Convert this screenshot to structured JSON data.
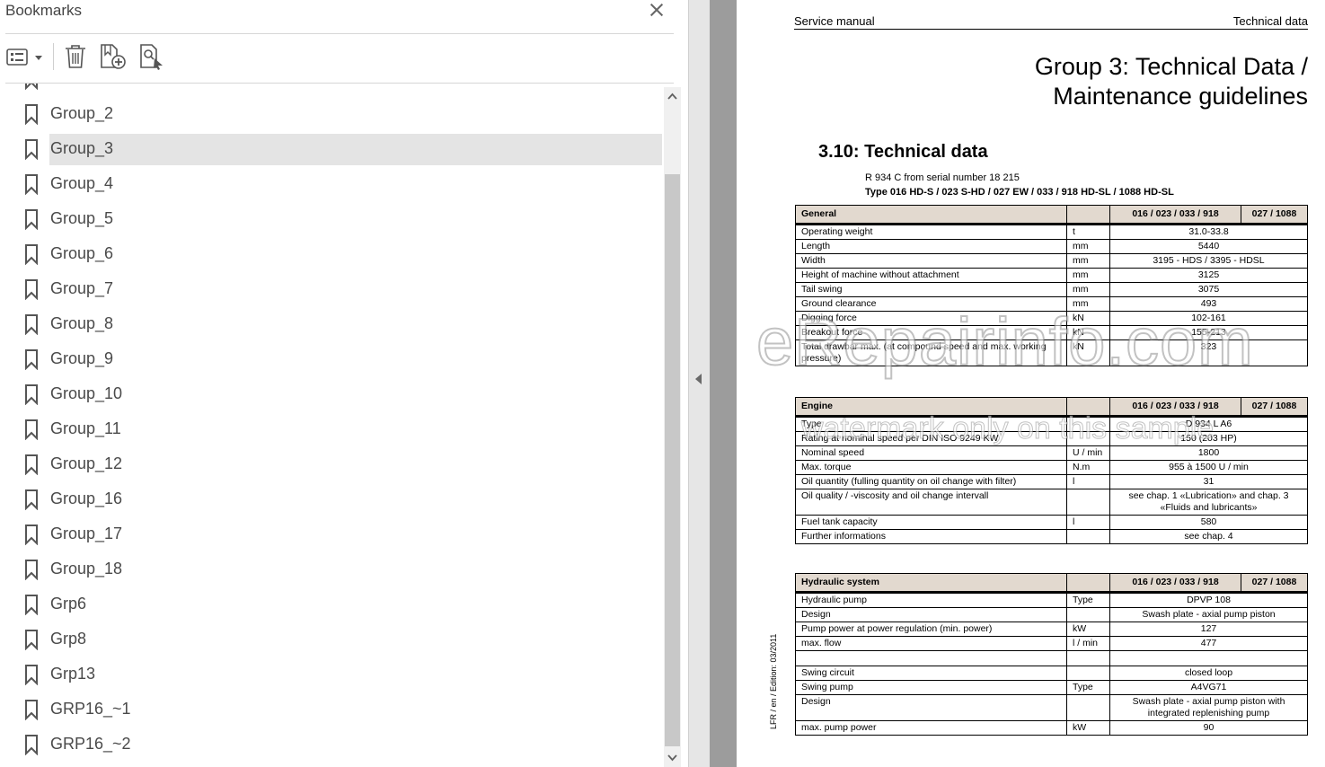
{
  "bookmarks": {
    "title": "Bookmarks",
    "items": [
      {
        "label": "Group_2",
        "selected": false
      },
      {
        "label": "Group_3",
        "selected": true
      },
      {
        "label": "Group_4",
        "selected": false
      },
      {
        "label": "Group_5",
        "selected": false
      },
      {
        "label": "Group_6",
        "selected": false
      },
      {
        "label": "Group_7",
        "selected": false
      },
      {
        "label": "Group_8",
        "selected": false
      },
      {
        "label": "Group_9",
        "selected": false
      },
      {
        "label": "Group_10",
        "selected": false
      },
      {
        "label": "Group_11",
        "selected": false
      },
      {
        "label": "Group_12",
        "selected": false
      },
      {
        "label": "Group_16",
        "selected": false
      },
      {
        "label": "Group_17",
        "selected": false
      },
      {
        "label": "Group_18",
        "selected": false
      },
      {
        "label": "Grp6",
        "selected": false
      },
      {
        "label": "Grp8",
        "selected": false
      },
      {
        "label": "Grp13",
        "selected": false
      },
      {
        "label": "GRP16_~1",
        "selected": false
      },
      {
        "label": "GRP16_~2",
        "selected": false
      }
    ]
  },
  "page": {
    "header_left": "Service manual",
    "header_right": "Technical data",
    "group_title_line1": "Group 3: Technical Data /",
    "group_title_line2": "Maintenance guidelines",
    "section_title": "3.10: Technical data",
    "model_line1": "R 934 C from serial number 18 215",
    "model_line2": "Type 016 HD-S / 023 S-HD / 027 EW / 033 / 918 HD-SL / 1088 HD-SL",
    "side_note": "LFR / en / Edition: 03/2011",
    "watermark_line1": "eRepairinfo.com",
    "watermark_line2": "watermark only on this sample"
  },
  "tables": {
    "general": {
      "title": "General",
      "col1": "016 / 023 / 033 / 918",
      "col2": "027 / 1088",
      "rows": [
        {
          "label": "Operating weight",
          "unit": "t",
          "value": "31.0-33.8"
        },
        {
          "label": "Length",
          "unit": "mm",
          "value": "5440"
        },
        {
          "label": "Width",
          "unit": "mm",
          "value": "3195 - HDS / 3395 - HDSL"
        },
        {
          "label": "Height of machine without attachment",
          "unit": "mm",
          "value": "3125"
        },
        {
          "label": "Tail swing",
          "unit": "mm",
          "value": "3075"
        },
        {
          "label": "Ground clearance",
          "unit": "mm",
          "value": "493"
        },
        {
          "label": "Digging force",
          "unit": "kN",
          "value": "102-161"
        },
        {
          "label": "Breakout force",
          "unit": "kN",
          "value": "155-213"
        },
        {
          "label": "Total drawbar max. (at compound speed and max. working pressure)",
          "unit": "kN",
          "value": "323"
        }
      ]
    },
    "engine": {
      "title": "Engine",
      "col1": "016 / 023 / 033 / 918",
      "col2": "027 / 1088",
      "rows": [
        {
          "label": "Type",
          "unit": "",
          "value": "D 934 L A6"
        },
        {
          "label": "Rating at nominal speed per DIN ISO 9249 KW",
          "unit": "",
          "value": "150 (203 HP)"
        },
        {
          "label": "Nominal speed",
          "unit": "U / min",
          "value": "1800"
        },
        {
          "label": "Max. torque",
          "unit": "N.m",
          "value": "955 à 1500 U / min"
        },
        {
          "label": "Oil quantity (fulling quantity on oil change with filter)",
          "unit": "l",
          "value": "31"
        },
        {
          "label": "Oil quality / -viscosity and oil change intervall",
          "unit": "",
          "value": "see chap. 1 «Lubrication» and chap. 3 «Fluids and lubricants»"
        },
        {
          "label": "Fuel tank capacity",
          "unit": "l",
          "value": "580"
        },
        {
          "label": "Further informations",
          "unit": "",
          "value": "see chap.  4"
        }
      ]
    },
    "hydraulic": {
      "title": "Hydraulic system",
      "col1": "016 / 023 / 033 / 918",
      "col2": "027 / 1088",
      "rows": [
        {
          "label": "Hydraulic pump",
          "unit": "Type",
          "value": "DPVP 108"
        },
        {
          "label": "Design",
          "unit": "",
          "value": "Swash plate - axial pump piston"
        },
        {
          "label": "Pump power at power regulation (min. power)",
          "unit": "kW",
          "value": "127"
        },
        {
          "label": "max. flow",
          "unit": "l / min",
          "value": "477"
        },
        {
          "label": "",
          "unit": "",
          "value": ""
        },
        {
          "label": "Swing circuit",
          "unit": "",
          "value": "closed loop"
        },
        {
          "label": "Swing pump",
          "unit": "Type",
          "value": "A4VG71"
        },
        {
          "label": "Design",
          "unit": "",
          "value": "Swash plate - axial pump piston with integrated replenishing pump"
        },
        {
          "label": "max. pump power",
          "unit": "kW",
          "value": "90"
        }
      ]
    }
  }
}
